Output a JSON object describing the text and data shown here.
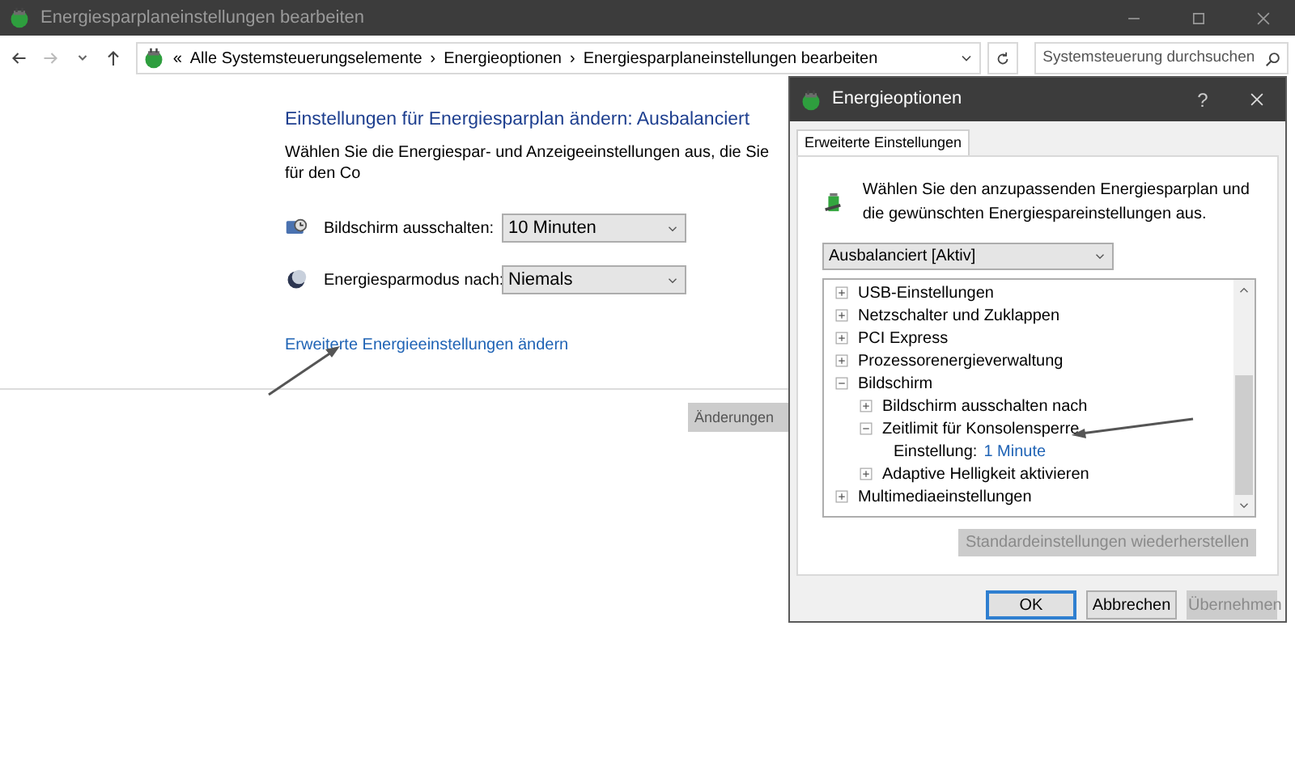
{
  "window": {
    "title": "Energiesparplaneinstellungen bearbeiten"
  },
  "address_bar": {
    "prefix": "«",
    "crumbs": [
      "Alle Systemsteuerungselemente",
      "Energieoptionen",
      "Energiesparplaneinstellungen bearbeiten"
    ],
    "separator": "›"
  },
  "search": {
    "placeholder": "Systemsteuerung durchsuchen"
  },
  "content": {
    "heading": "Einstellungen für Energiesparplan ändern: Ausbalanciert",
    "description": "Wählen Sie die Energiespar- und Anzeigeeinstellungen aus, die Sie für den Co",
    "settings": [
      {
        "kind": "display",
        "label": "Bildschirm ausschalten:",
        "value": "10 Minuten"
      },
      {
        "kind": "sleep",
        "label": "Energiesparmodus nach:",
        "value": "Niemals"
      }
    ],
    "link": "Erweiterte Energieeinstellungen ändern",
    "save_button": "Änderungen"
  },
  "dialog": {
    "title": "Energieoptionen",
    "help": "?",
    "tabs": [
      {
        "label": "Erweiterte Einstellungen",
        "selected": true
      }
    ],
    "intro": "Wählen Sie den anzupassenden Energiesparplan und die gewünschten Energiespareinstellungen aus.",
    "plan": "Ausbalanciert [Aktiv]",
    "tree": [
      {
        "label": "USB-Einstellungen",
        "expanded": false
      },
      {
        "label": "Netzschalter und Zuklappen",
        "expanded": false
      },
      {
        "label": "PCI Express",
        "expanded": false
      },
      {
        "label": "Prozessorenergieverwaltung",
        "expanded": false
      },
      {
        "label": "Bildschirm",
        "expanded": true,
        "children": [
          {
            "label": "Bildschirm ausschalten nach",
            "expanded": false
          },
          {
            "label": "Zeitlimit für Konsolensperre",
            "expanded": true,
            "children": [
              {
                "kind": "setting",
                "label": "Einstellung:",
                "value": "1 Minute"
              }
            ]
          },
          {
            "label": "Adaptive Helligkeit aktivieren",
            "expanded": false
          }
        ]
      },
      {
        "label": "Multimediaeinstellungen",
        "expanded": false
      }
    ],
    "restore_button": {
      "label": "Standardeinstellungen wiederherstellen",
      "disabled": true
    },
    "buttons": [
      {
        "label": "OK",
        "disabled": false,
        "default": true
      },
      {
        "label": "Abbrechen",
        "disabled": false,
        "default": false
      },
      {
        "label": "Übernehmen",
        "disabled": true,
        "default": false
      }
    ]
  }
}
